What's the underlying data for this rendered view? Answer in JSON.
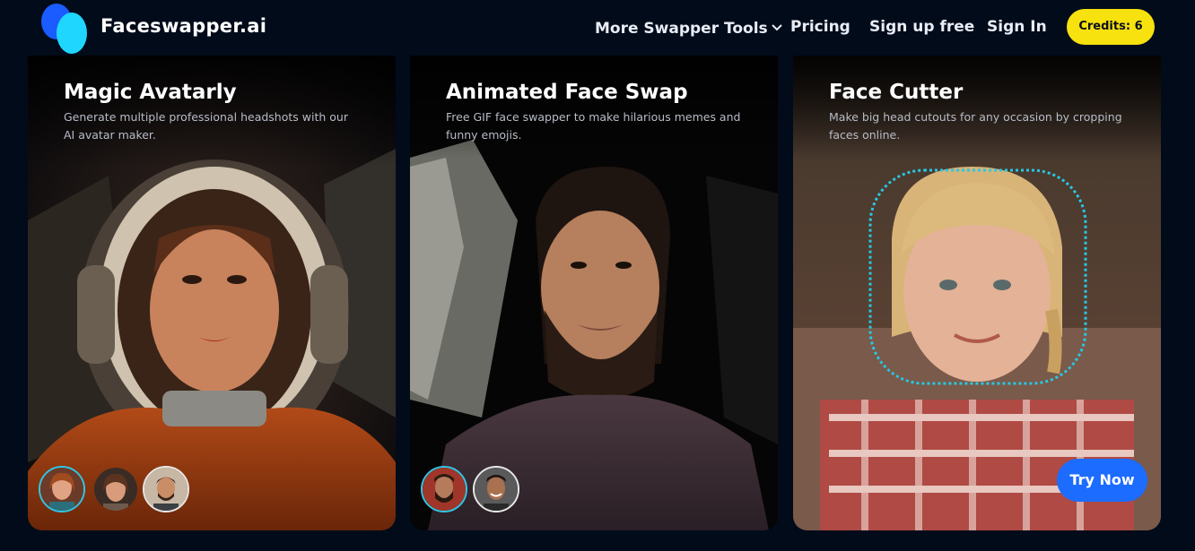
{
  "brand": {
    "name": "Faceswapper.ai",
    "accent": "#1fd6ff"
  },
  "nav": {
    "more_tools": "More Swapper Tools",
    "pricing": "Pricing",
    "signup": "Sign up free",
    "signin": "Sign In",
    "credits": "Credits: 6",
    "credits_color": "#f7e10e"
  },
  "cards": [
    {
      "title": "Magic Avatarly",
      "description": "Generate multiple professional headshots with our AI avatar maker.",
      "image": "astronaut-woman-portrait",
      "thumbnails": [
        "woman-avatar",
        "woman-avatar-2",
        "man-avatar"
      ]
    },
    {
      "title": "Animated Face Swap",
      "description": "Free GIF face swapper to make hilarious memes and funny emojis.",
      "image": "bearded-man-portrait",
      "thumbnails": [
        "bearded-man-avatar",
        "smiling-man-avatar"
      ]
    },
    {
      "title": "Face Cutter",
      "description": "Make big head cutouts for any occasion by cropping faces online.",
      "image": "girl-face-cutout",
      "button": "Try Now",
      "button_color": "#1c6cff"
    }
  ]
}
